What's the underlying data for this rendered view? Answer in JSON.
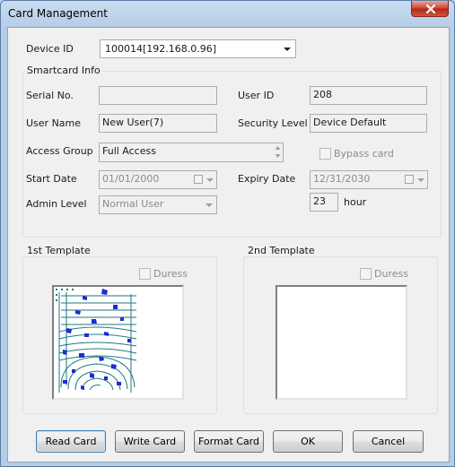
{
  "window": {
    "title": "Card Management"
  },
  "device": {
    "label": "Device ID",
    "value": "100014[192.168.0.96]"
  },
  "smartcard": {
    "group_label": "Smartcard Info",
    "serial_label": "Serial No.",
    "serial_value": "",
    "user_id_label": "User ID",
    "user_id_value": "208",
    "user_name_label": "User Name",
    "user_name_value": "New User(7)",
    "security_label": "Security Level",
    "security_value": "Device Default",
    "access_group_label": "Access Group",
    "access_group_value": "Full Access",
    "bypass_label": "Bypass card",
    "start_date_label": "Start Date",
    "start_date_value": "01/01/2000",
    "expiry_date_label": "Expiry Date",
    "expiry_date_value": "12/31/2030",
    "admin_level_label": "Admin Level",
    "admin_level_value": "Normal User",
    "hour_value": "23",
    "hour_label": "hour"
  },
  "template1": {
    "label": "1st Template",
    "duress_label": "Duress"
  },
  "template2": {
    "label": "2nd Template",
    "duress_label": "Duress"
  },
  "buttons": {
    "read_card": "Read Card",
    "write_card": "Write Card",
    "format_card": "Format Card",
    "ok": "OK",
    "cancel": "Cancel"
  },
  "icons": {
    "close": "close-icon",
    "dropdown": "chevron-down-icon",
    "calendar": "calendar-icon",
    "fingerprint": "fingerprint-image"
  }
}
